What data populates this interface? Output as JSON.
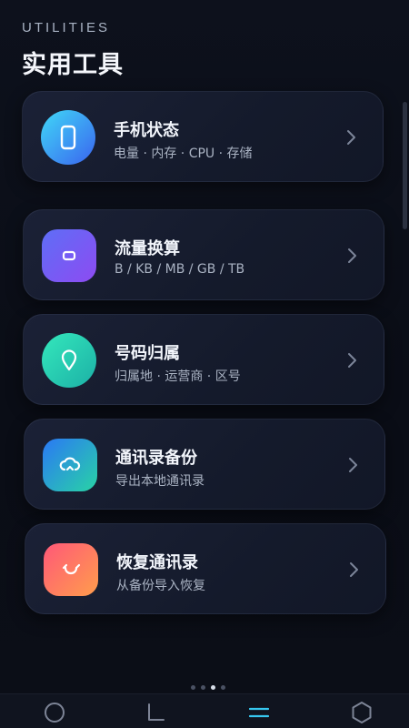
{
  "header": {
    "overline": "UTILITIES",
    "title": "实用工具"
  },
  "tools": [
    {
      "name": "手机状态",
      "desc": "电量 · 内存 · CPU · 存储",
      "icon": "phone-icon",
      "color_from": "#3fd1f6",
      "color_to": "#3b6cf0"
    },
    {
      "name": "流量换算",
      "desc": "B / KB / MB / GB / TB",
      "icon": "data-unit-icon",
      "color_from": "#6b63f5",
      "color_to": "#8c4df3"
    },
    {
      "name": "号码归属",
      "desc": "归属地 · 运营商 · 区号",
      "icon": "location-pin-icon",
      "color_from": "#2fe3b5",
      "color_to": "#1fb3a8"
    },
    {
      "name": "通讯录备份",
      "desc": "导出本地通讯录",
      "icon": "cloud-icon",
      "color_from": "#2b7ff5",
      "color_to": "#27d0a7"
    },
    {
      "name": "恢复通讯录",
      "desc": "从备份导入恢复",
      "icon": "restore-icon",
      "color_from": "#ff5d7a",
      "color_to": "#ff9b4e"
    }
  ],
  "pager": {
    "count": 4,
    "active_index": 2
  },
  "nav": {
    "items": [
      {
        "icon": "circle-icon",
        "active": false
      },
      {
        "icon": "corner-icon",
        "active": false
      },
      {
        "icon": "menu-lines-icon",
        "active": true
      },
      {
        "icon": "hexagon-icon",
        "active": false
      }
    ],
    "active_color": "#37c8f0"
  }
}
